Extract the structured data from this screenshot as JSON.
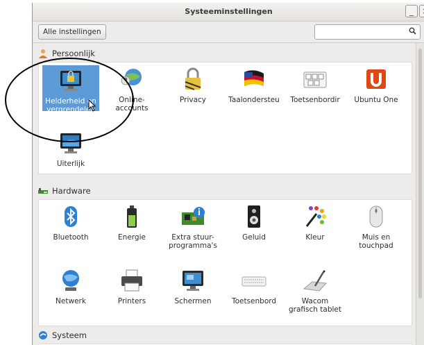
{
  "window": {
    "title": "Systeeminstellingen",
    "minimize_label": "_",
    "close_label": "×"
  },
  "toolbar": {
    "all_settings_label": "Alle instellingen",
    "search_value": "",
    "search_icon_glyph": "⚲"
  },
  "sections": {
    "personal": {
      "label": "Persoonlijk",
      "items": [
        {
          "label": "Helderheid en vergrendelen",
          "selected": true
        },
        {
          "label": "Online-accounts"
        },
        {
          "label": "Privacy"
        },
        {
          "label": "Taalondersteu"
        },
        {
          "label": "Toetsenbordir"
        },
        {
          "label": "Ubuntu One"
        },
        {
          "label": "Uiterlijk"
        }
      ]
    },
    "hardware": {
      "label": "Hardware",
      "items": [
        {
          "label": "Bluetooth"
        },
        {
          "label": "Energie"
        },
        {
          "label": "Extra stuur-programma's"
        },
        {
          "label": "Geluid"
        },
        {
          "label": "Kleur"
        },
        {
          "label": "Muis en touchpad"
        },
        {
          "label": "Netwerk"
        },
        {
          "label": "Printers"
        },
        {
          "label": "Schermen"
        },
        {
          "label": "Toetsenbord"
        },
        {
          "label": "Wacom grafisch tablet"
        }
      ]
    },
    "system": {
      "label": "Systeem"
    }
  },
  "colors": {
    "selection": "#5d9bd6",
    "window_bg": "#eeecea",
    "panel_bg": "#ffffff"
  }
}
